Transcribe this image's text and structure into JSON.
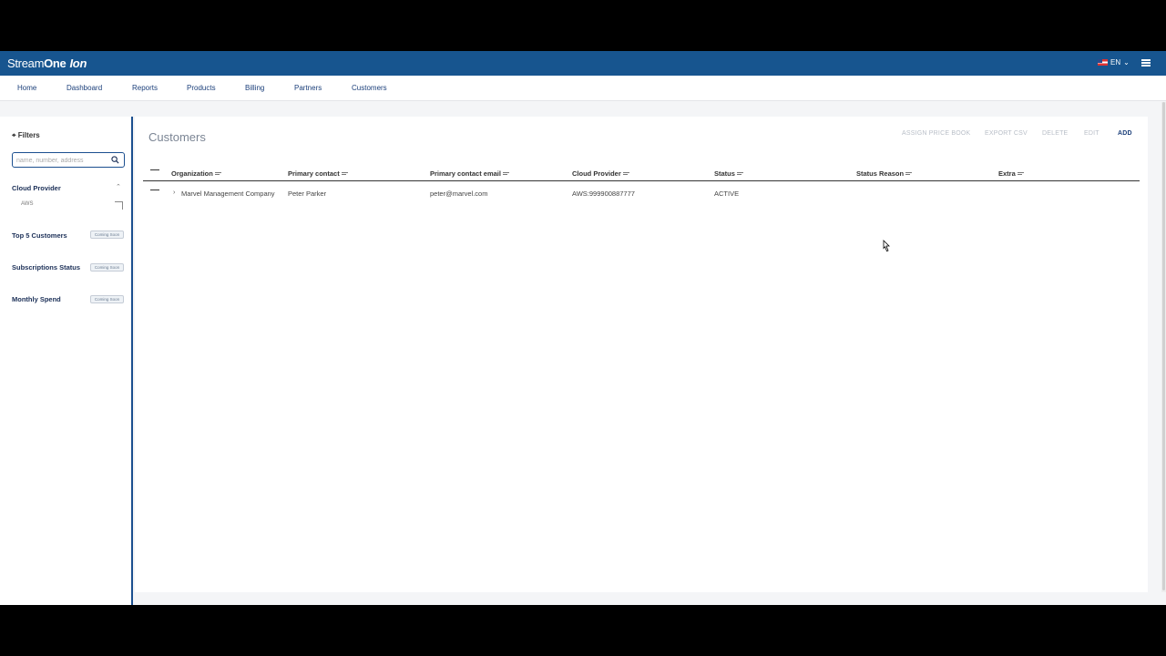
{
  "app": {
    "brand_part1": "Stream",
    "brand_part2": "One",
    "brand_part3": "Ion",
    "language": "EN"
  },
  "nav": {
    "items": [
      "Home",
      "Dashboard",
      "Reports",
      "Products",
      "Billing",
      "Partners",
      "Customers"
    ]
  },
  "sidebar": {
    "filter_title": "Filters",
    "search_placeholder": "name, number, address",
    "cloud_provider_label": "Cloud Provider",
    "cloud_provider_option": "AWS",
    "sections": [
      {
        "label": "Top 5 Customers",
        "badge": "Coming Soon"
      },
      {
        "label": "Subscriptions Status",
        "badge": "Coming Soon"
      },
      {
        "label": "Monthly Spend",
        "badge": "Coming Soon"
      }
    ]
  },
  "main": {
    "title": "Customers",
    "actions": {
      "assign_price_book": "ASSIGN PRICE BOOK",
      "export_csv": "EXPORT CSV",
      "delete": "DELETE",
      "edit": "EDIT",
      "add": "ADD"
    },
    "columns": [
      "Organization",
      "Primary contact",
      "Primary contact email",
      "Cloud Provider",
      "Status",
      "Status Reason",
      "Extra"
    ],
    "rows": [
      {
        "organization": "Marvel Management Company",
        "primary_contact": "Peter Parker",
        "primary_contact_email": "peter@marvel.com",
        "cloud_provider": "AWS:999900887777",
        "status": "ACTIVE",
        "status_reason": "",
        "extra": ""
      }
    ]
  },
  "colors": {
    "topbar": "#17558f",
    "nav_text": "#1b3f7a",
    "accent": "#1b4f8f"
  }
}
